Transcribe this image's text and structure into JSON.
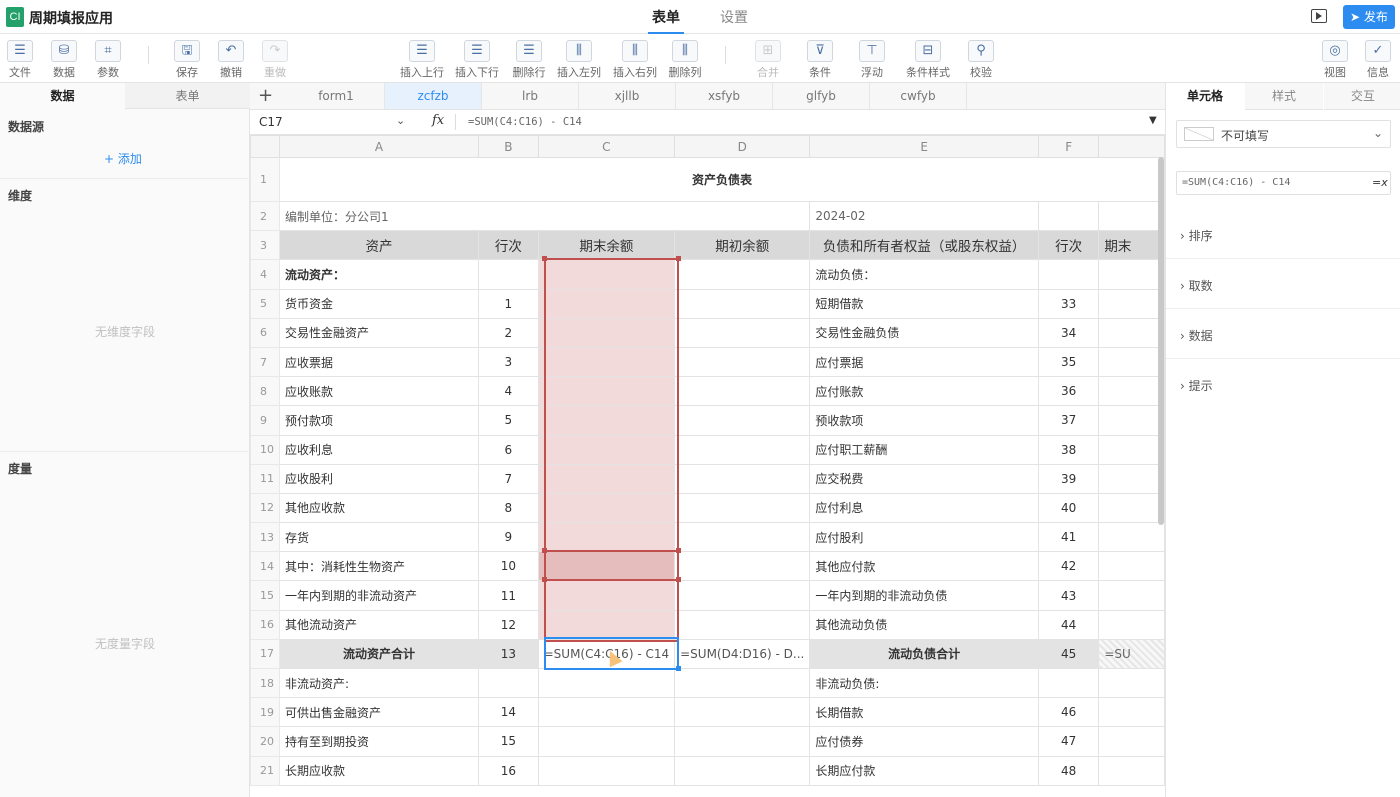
{
  "app": {
    "logo": "CI",
    "title": "周期填报应用",
    "tabs": [
      "表单",
      "设置"
    ],
    "publish": "发布"
  },
  "toolbar": {
    "left": [
      {
        "icon": "menu-icon",
        "label": "文件"
      },
      {
        "icon": "database-icon",
        "label": "数据"
      },
      {
        "icon": "params-icon",
        "label": "参数"
      }
    ],
    "edit": [
      {
        "icon": "save-icon",
        "label": "保存"
      },
      {
        "icon": "undo-icon",
        "label": "撤销"
      },
      {
        "icon": "redo-icon",
        "label": "重做"
      }
    ],
    "rows": [
      {
        "icon": "insert-row-above-icon",
        "label": "插入上行"
      },
      {
        "icon": "insert-row-below-icon",
        "label": "插入下行"
      },
      {
        "icon": "delete-row-icon",
        "label": "删除行"
      },
      {
        "icon": "insert-col-left-icon",
        "label": "插入左列"
      },
      {
        "icon": "insert-col-right-icon",
        "label": "插入右列"
      },
      {
        "icon": "delete-col-icon",
        "label": "删除列"
      }
    ],
    "cond": [
      {
        "icon": "merge-icon",
        "label": "合并"
      },
      {
        "icon": "filter-icon",
        "label": "条件"
      },
      {
        "icon": "float-icon",
        "label": "浮动"
      },
      {
        "icon": "cond-style-icon",
        "label": "条件样式"
      },
      {
        "icon": "verify-icon",
        "label": "校验"
      }
    ],
    "right": [
      {
        "icon": "view-icon",
        "label": "视图"
      },
      {
        "icon": "info-icon",
        "label": "信息"
      }
    ]
  },
  "left_panel": {
    "tabs": [
      "数据",
      "表单"
    ],
    "datasource": "数据源",
    "add": "+ 添加",
    "dimension": "维度",
    "no_dimension": "无维度字段",
    "measure": "度量",
    "no_measure": "无度量字段"
  },
  "sheet_tabs": [
    "form1",
    "zcfzb",
    "lrb",
    "xjllb",
    "xsfyb",
    "glfyb",
    "cwfyb"
  ],
  "formula_bar": {
    "cell": "C17",
    "fx": "fx",
    "formula": "=SUM(C4:C16) - C14"
  },
  "grid": {
    "col_headers": [
      "A",
      "B",
      "C",
      "D",
      "E",
      "F",
      ""
    ],
    "title": "资产负债表",
    "unit_label": "编制单位：分公司1",
    "period": "2024-02",
    "header": [
      "资产",
      "行次",
      "期末余额",
      "期初余额",
      "负债和所有者权益（或股东权益）",
      "行次",
      "期末"
    ],
    "rows": [
      {
        "n": "4",
        "a": "流动资产：",
        "b": "",
        "e": "流动负债：",
        "f": ""
      },
      {
        "n": "5",
        "a": "货币资金",
        "b": "1",
        "e": "短期借款",
        "f": "33"
      },
      {
        "n": "6",
        "a": "交易性金融资产",
        "b": "2",
        "e": "交易性金融负债",
        "f": "34"
      },
      {
        "n": "7",
        "a": "应收票据",
        "b": "3",
        "e": "应付票据",
        "f": "35"
      },
      {
        "n": "8",
        "a": "应收账款",
        "b": "4",
        "e": "应付账款",
        "f": "36"
      },
      {
        "n": "9",
        "a": "预付款项",
        "b": "5",
        "e": "预收款项",
        "f": "37"
      },
      {
        "n": "10",
        "a": "应收利息",
        "b": "6",
        "e": "应付职工薪酬",
        "f": "38"
      },
      {
        "n": "11",
        "a": "应收股利",
        "b": "7",
        "e": "应交税费",
        "f": "39"
      },
      {
        "n": "12",
        "a": "其他应收款",
        "b": "8",
        "e": "应付利息",
        "f": "40"
      },
      {
        "n": "13",
        "a": "存货",
        "b": "9",
        "e": "应付股利",
        "f": "41"
      },
      {
        "n": "14",
        "a": "其中：消耗性生物资产",
        "b": "10",
        "e": "其他应付款",
        "f": "42"
      },
      {
        "n": "15",
        "a": "一年内到期的非流动资产",
        "b": "11",
        "e": "一年内到期的非流动负债",
        "f": "43"
      },
      {
        "n": "16",
        "a": "其他流动资产",
        "b": "12",
        "e": "其他流动负债",
        "f": "44"
      },
      {
        "n": "17",
        "a": "流动资产合计",
        "b": "13",
        "c": "=SUM(C4:C16) - C14",
        "d": "=SUM(D4:D16) - D...",
        "e": "流动负债合计",
        "f": "45",
        "g": "=SU"
      },
      {
        "n": "18",
        "a": "非流动资产:",
        "b": "",
        "e": "非流动负债:",
        "f": ""
      },
      {
        "n": "19",
        "a": "可供出售金融资产",
        "b": "14",
        "e": "长期借款",
        "f": "46"
      },
      {
        "n": "20",
        "a": "持有至到期投资",
        "b": "15",
        "e": "应付债券",
        "f": "47"
      },
      {
        "n": "21",
        "a": "长期应收款",
        "b": "16",
        "e": "长期应付款",
        "f": "48"
      }
    ]
  },
  "right_panel": {
    "tabs": [
      "单元格",
      "样式",
      "交互"
    ],
    "editable": "不可填写",
    "formula": "=SUM(C4:C16) - C14",
    "formula_btn": "=x",
    "sections": [
      "排序",
      "取数",
      "数据",
      "提示"
    ]
  },
  "colors": {
    "accent": "#2d8cf0",
    "selection": "#c0504d",
    "header_fill": "#d9d9d9"
  }
}
